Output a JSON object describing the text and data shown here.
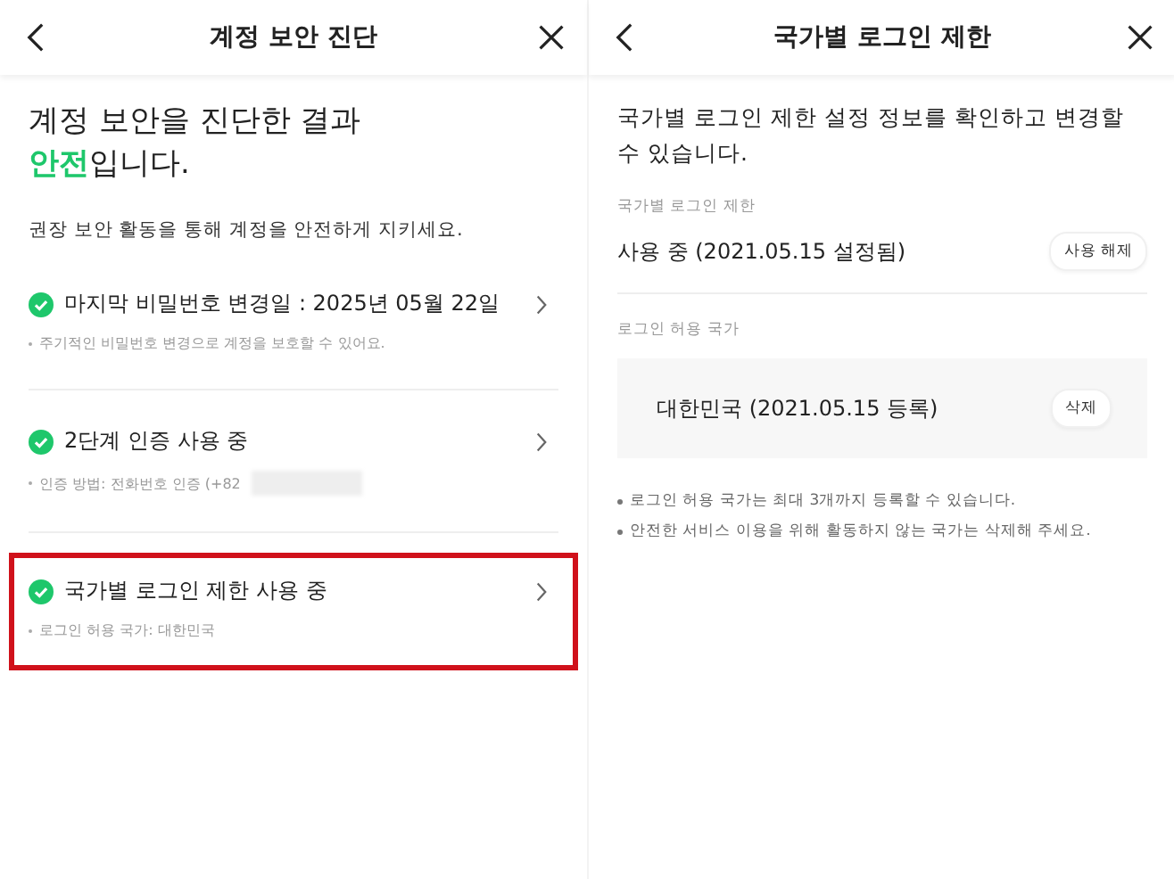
{
  "left": {
    "header": {
      "title": "계정 보안 진단"
    },
    "headline": "계정 보안을 진단한 결과",
    "result": {
      "status": "안전",
      "rest": "입니다."
    },
    "subtitle": "권장 보안 활동을 통해 계정을 안전하게 지키세요.",
    "items": [
      {
        "title": "마지막 비밀번호 변경일 : 2025년 05월 22일",
        "detail": "주기적인 비밀번호 변경으로 계정을 보호할 수 있어요.",
        "redacted": false,
        "highlighted": false
      },
      {
        "title": "2단계 인증 사용 중",
        "detail": "인증 방법: 전화번호 인증 (+82",
        "redacted": true,
        "highlighted": false
      },
      {
        "title": "국가별 로그인 제한 사용 중",
        "detail": "로그인 허용 국가: 대한민국",
        "redacted": false,
        "highlighted": true
      }
    ]
  },
  "right": {
    "header": {
      "title": "국가별 로그인 제한"
    },
    "description": "국가별 로그인 제한 설정 정보를 확인하고 변경할 수 있습니다.",
    "restriction": {
      "label": "국가별 로그인 제한",
      "value": "사용 중 (2021.05.15 설정됨)",
      "button": "사용 해제"
    },
    "countries": {
      "label": "로그인 허용 국가",
      "items": [
        {
          "name": "대한민국 (2021.05.15 등록)",
          "button": "삭제"
        }
      ]
    },
    "notes": [
      "로그인 허용 국가는 최대 3개까지 등록할 수 있습니다.",
      "안전한 서비스 이용을 위해 활동하지 않는 국가는 삭제해 주세요."
    ]
  }
}
